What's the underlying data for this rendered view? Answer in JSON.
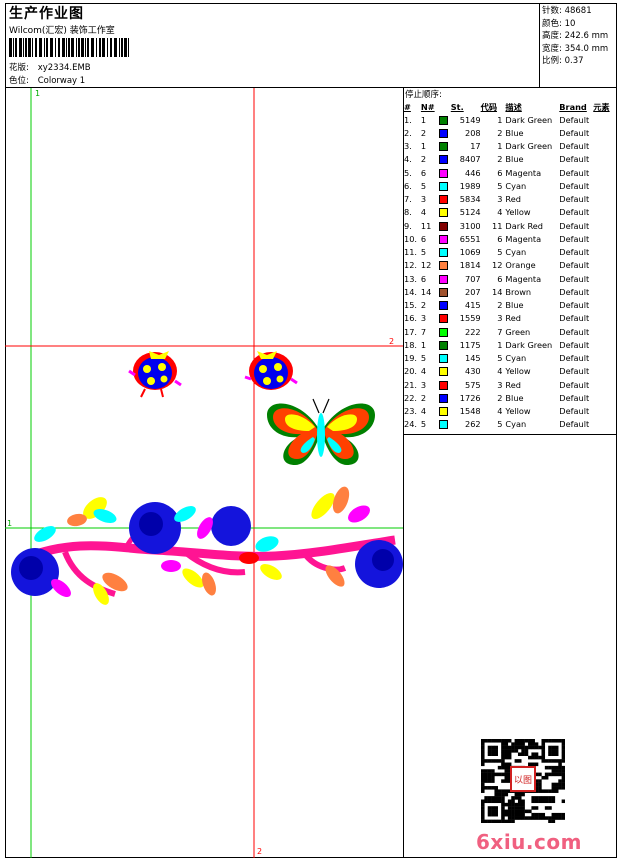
{
  "header": {
    "title": "生产作业图",
    "studio": "Wilcom(汇宏) 装饰工作室",
    "design_label": "花版:",
    "design_value": "xy2334.EMB",
    "colorway_label": "色位:",
    "colorway_value": "Colorway 1"
  },
  "stats": [
    {
      "label": "针数:",
      "value": "48681"
    },
    {
      "label": "颜色:",
      "value": "10"
    },
    {
      "label": "高度:",
      "value": "242.6 mm"
    },
    {
      "label": "宽度:",
      "value": "354.0 mm"
    },
    {
      "label": "比例:",
      "value": "0.37"
    }
  ],
  "canvas": {
    "markers": {
      "left_top": "1",
      "h_mid_right": "2",
      "h_lower_left": "1",
      "v_bottom": "2"
    },
    "colors": {
      "green_guide": "#00cc00",
      "red_guide": "#ff0000"
    }
  },
  "stop_sequence": {
    "title": "停止顺序:",
    "headers": {
      "idx": "#",
      "n": "N#",
      "st": "St.",
      "code": "代码",
      "desc": "描述",
      "brand": "Brand",
      "elem": "元素"
    },
    "rows": [
      {
        "idx": "1.",
        "n": "1",
        "color": "#008000",
        "st": "5149",
        "code": "1",
        "desc": "Dark Green",
        "brand": "Default"
      },
      {
        "idx": "2.",
        "n": "2",
        "color": "#0000ff",
        "st": "208",
        "code": "2",
        "desc": "Blue",
        "brand": "Default"
      },
      {
        "idx": "3.",
        "n": "1",
        "color": "#008000",
        "st": "17",
        "code": "1",
        "desc": "Dark Green",
        "brand": "Default"
      },
      {
        "idx": "4.",
        "n": "2",
        "color": "#0000ff",
        "st": "8407",
        "code": "2",
        "desc": "Blue",
        "brand": "Default"
      },
      {
        "idx": "5.",
        "n": "6",
        "color": "#ff00ff",
        "st": "446",
        "code": "6",
        "desc": "Magenta",
        "brand": "Default"
      },
      {
        "idx": "6.",
        "n": "5",
        "color": "#00ffff",
        "st": "1989",
        "code": "5",
        "desc": "Cyan",
        "brand": "Default"
      },
      {
        "idx": "7.",
        "n": "3",
        "color": "#ff0000",
        "st": "5834",
        "code": "3",
        "desc": "Red",
        "brand": "Default"
      },
      {
        "idx": "8.",
        "n": "4",
        "color": "#ffff00",
        "st": "5124",
        "code": "4",
        "desc": "Yellow",
        "brand": "Default"
      },
      {
        "idx": "9.",
        "n": "11",
        "color": "#800000",
        "st": "3100",
        "code": "11",
        "desc": "Dark Red",
        "brand": "Default"
      },
      {
        "idx": "10.",
        "n": "6",
        "color": "#ff00ff",
        "st": "6551",
        "code": "6",
        "desc": "Magenta",
        "brand": "Default"
      },
      {
        "idx": "11.",
        "n": "5",
        "color": "#00ffff",
        "st": "1069",
        "code": "5",
        "desc": "Cyan",
        "brand": "Default"
      },
      {
        "idx": "12.",
        "n": "12",
        "color": "#ff8040",
        "st": "1814",
        "code": "12",
        "desc": "Orange",
        "brand": "Default"
      },
      {
        "idx": "13.",
        "n": "6",
        "color": "#ff00ff",
        "st": "707",
        "code": "6",
        "desc": "Magenta",
        "brand": "Default"
      },
      {
        "idx": "14.",
        "n": "14",
        "color": "#a0522d",
        "st": "207",
        "code": "14",
        "desc": "Brown",
        "brand": "Default"
      },
      {
        "idx": "15.",
        "n": "2",
        "color": "#0000ff",
        "st": "415",
        "code": "2",
        "desc": "Blue",
        "brand": "Default"
      },
      {
        "idx": "16.",
        "n": "3",
        "color": "#ff0000",
        "st": "1559",
        "code": "3",
        "desc": "Red",
        "brand": "Default"
      },
      {
        "idx": "17.",
        "n": "7",
        "color": "#00ff00",
        "st": "222",
        "code": "7",
        "desc": "Green",
        "brand": "Default"
      },
      {
        "idx": "18.",
        "n": "1",
        "color": "#008000",
        "st": "1175",
        "code": "1",
        "desc": "Dark Green",
        "brand": "Default"
      },
      {
        "idx": "19.",
        "n": "5",
        "color": "#00ffff",
        "st": "145",
        "code": "5",
        "desc": "Cyan",
        "brand": "Default"
      },
      {
        "idx": "20.",
        "n": "4",
        "color": "#ffff00",
        "st": "430",
        "code": "4",
        "desc": "Yellow",
        "brand": "Default"
      },
      {
        "idx": "21.",
        "n": "3",
        "color": "#ff0000",
        "st": "575",
        "code": "3",
        "desc": "Red",
        "brand": "Default"
      },
      {
        "idx": "22.",
        "n": "2",
        "color": "#0000ff",
        "st": "1726",
        "code": "2",
        "desc": "Blue",
        "brand": "Default"
      },
      {
        "idx": "23.",
        "n": "4",
        "color": "#ffff00",
        "st": "1548",
        "code": "4",
        "desc": "Yellow",
        "brand": "Default"
      },
      {
        "idx": "24.",
        "n": "5",
        "color": "#00ffff",
        "st": "262",
        "code": "5",
        "desc": "Cyan",
        "brand": "Default"
      }
    ]
  },
  "footer": {
    "logo_text": "6xiu.com",
    "qr_stamp_text": "以图"
  }
}
